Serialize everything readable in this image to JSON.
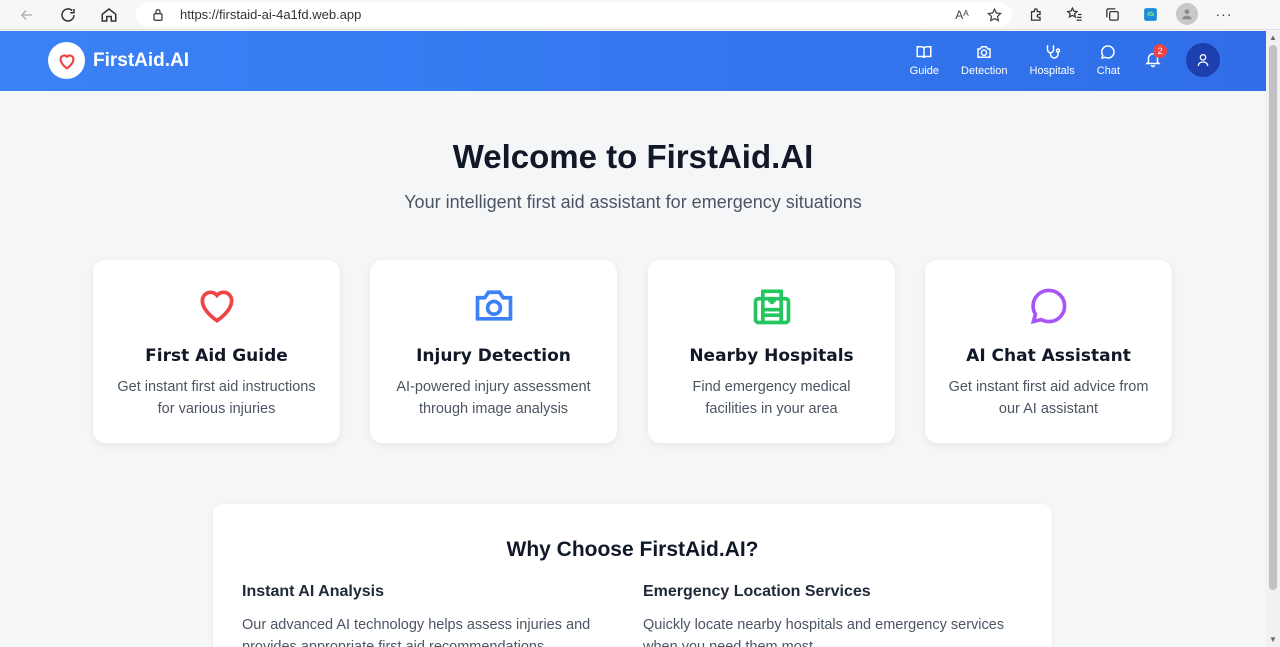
{
  "browser": {
    "url": "https://firstaid-ai-4a1fd.web.app",
    "reader_icon": "Aᴬ"
  },
  "header": {
    "brand": "FirstAid.AI",
    "nav": [
      {
        "label": "Guide",
        "icon": "book-open-icon"
      },
      {
        "label": "Detection",
        "icon": "camera-icon"
      },
      {
        "label": "Hospitals",
        "icon": "stethoscope-icon"
      },
      {
        "label": "Chat",
        "icon": "chat-bubble-icon"
      }
    ],
    "notification_count": "2"
  },
  "hero": {
    "title": "Welcome to FirstAid.AI",
    "subtitle": "Your intelligent first aid assistant for emergency situations"
  },
  "cards": [
    {
      "title": "First Aid Guide",
      "desc": "Get instant first aid instructions for various injuries",
      "icon": "heart-icon",
      "color": "#ef4444"
    },
    {
      "title": "Injury Detection",
      "desc": "AI-powered injury assessment through image analysis",
      "icon": "camera-icon",
      "color": "#3b82f6"
    },
    {
      "title": "Nearby Hospitals",
      "desc": "Find emergency medical facilities in your area",
      "icon": "hospital-icon",
      "color": "#22c55e"
    },
    {
      "title": "AI Chat Assistant",
      "desc": "Get instant first aid advice from our AI assistant",
      "icon": "chat-bubble-icon",
      "color": "#a855f7"
    }
  ],
  "why": {
    "title": "Why Choose FirstAid.AI?",
    "features": [
      {
        "title": "Instant AI Analysis",
        "desc": "Our advanced AI technology helps assess injuries and provides appropriate first aid recommendations."
      },
      {
        "title": "Emergency Location Services",
        "desc": "Quickly locate nearby hospitals and emergency services when you need them most."
      }
    ]
  },
  "colors": {
    "header_blue": "#3b82f6",
    "badge_red": "#ef4444",
    "user_button": "#1e40af"
  }
}
